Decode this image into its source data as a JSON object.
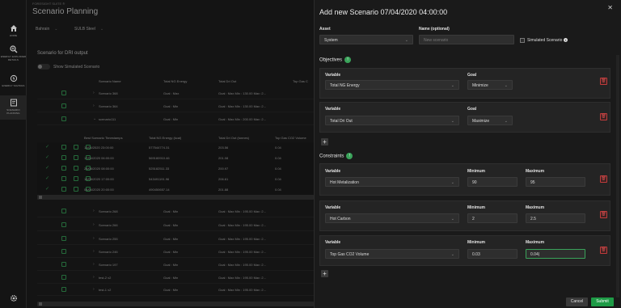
{
  "app": {
    "brand": "FORESIGHT SUITE ®",
    "page_title": "Scenario Planning"
  },
  "nav": {
    "items": [
      {
        "label": "HOME",
        "icon": "home-icon"
      },
      {
        "label": "ENERGY EXPLORER DETAILS",
        "icon": "search-icon"
      },
      {
        "label": "ENERGY SAVINGS",
        "icon": "energy-savings-icon"
      },
      {
        "label": "SCENARIO PLANNING",
        "icon": "scenario-planning-icon"
      }
    ],
    "settings_icon": "gear-icon"
  },
  "filters": {
    "region": "Bahrain",
    "asset": "SULB Steel"
  },
  "section": {
    "title": "Scenario for DRI output",
    "toggle_label": "Show Simulated Scenario"
  },
  "table": {
    "headers": [
      "Scenario Name",
      "Total NG Energy",
      "Total Dri Out",
      "Top Gas C"
    ],
    "rows_top": [
      {
        "name": "Scenario 368",
        "ng": "Goal : Max",
        "dri": "Goal : Max Min : 130.00 Max :2..."
      },
      {
        "name": "Scenario 364",
        "ng": "Goal : Min",
        "dri": "Goal : Max Min : 130.00 Max :2..."
      },
      {
        "name": "scenario111",
        "ng": "Goal : Min",
        "dri": "Goal : Max Min : 200.00 Max :2..."
      }
    ],
    "sub_headers": [
      "Best Scenario Timestamps",
      "Total NG Energy (kcal)",
      "Total Dri Out (tonnes)",
      "Top Gas CO2 Volume"
    ],
    "sub_rows": [
      {
        "ts": "11/04/2020 23:00:00",
        "ng": "577544774.31",
        "dri": "203.56",
        "co2": "0.04"
      },
      {
        "ts": "17/04/2020 06:00:00",
        "ng": "569180910.46",
        "dri": "201.08",
        "co2": "0.04"
      },
      {
        "ts": "28/08/2020 08:00:00",
        "ng": "525182511.33",
        "dri": "200.97",
        "co2": "0.04"
      },
      {
        "ts": "16/08/2020 17:00:00",
        "ng": "543491191.96",
        "dri": "206.61",
        "co2": "0.04"
      },
      {
        "ts": "04/04/2020 20:00:00",
        "ng": "490450657.14",
        "dri": "201.88",
        "co2": "0.04"
      }
    ],
    "rows_bottom": [
      {
        "name": "Scenario 268",
        "ng": "Goal : Min",
        "dri": "Goal : Max Min : 195.00 Max :2..."
      },
      {
        "name": "Scenario 266",
        "ng": "Goal : Min",
        "dri": "Goal : Max Min : 195.00 Max :2..."
      },
      {
        "name": "Scenario 255",
        "ng": "Goal : Min",
        "dri": "Goal : Max Min : 195.00 Max :2..."
      },
      {
        "name": "Scenario 246",
        "ng": "Goal : Min",
        "dri": "Goal : Max Min : 195.00 Max :2..."
      },
      {
        "name": "Scenario 197",
        "ng": "Goal : Min",
        "dri": "Goal : Max Min : 195.00 Max :2..."
      },
      {
        "name": "test-2 v2",
        "ng": "Goal : Min",
        "dri": "Goal : Max Min : 195.00 Max :2..."
      },
      {
        "name": "test-1 v2",
        "ng": "Goal : Min",
        "dri": "Goal : Max Min : 195.00 Max :2..."
      }
    ]
  },
  "panel": {
    "title": "Add new Scenario 07/04/2020 04:00:00",
    "asset_label": "Asset",
    "asset_value": "System",
    "name_label": "Name (optional)",
    "name_placeholder": "New scenario",
    "simulated_label": "Simulated Scenario",
    "objectives": {
      "title": "Objectives",
      "count": "!",
      "items": [
        {
          "variable_label": "Variable",
          "variable": "Total NG Energy",
          "goal_label": "Goal",
          "goal": "Minimize"
        },
        {
          "variable_label": "Variable",
          "variable": "Total Dri Out",
          "goal_label": "Goal",
          "goal": "Maximize"
        }
      ]
    },
    "constraints": {
      "title": "Constraints",
      "count": "!",
      "items": [
        {
          "variable_label": "Variable",
          "variable": "Hot Metalization",
          "min_label": "Minimum",
          "min": "90",
          "max_label": "Maximum",
          "max": "95"
        },
        {
          "variable_label": "Variable",
          "variable": "Hot Carbon",
          "min_label": "Minimum",
          "min": "2",
          "max_label": "Maximum",
          "max": "2.5"
        },
        {
          "variable_label": "Variable",
          "variable": "Top Gas CO2 Volume",
          "min_label": "Minimum",
          "min": "0.03",
          "max_label": "Maximum",
          "max": "0.04|"
        }
      ]
    },
    "add_symbol": "+",
    "cancel_label": "Cancel",
    "submit_label": "Submit"
  },
  "colors": {
    "accent": "#1e9b46",
    "danger": "#c23b3b",
    "panel_bg": "#1a1a1a"
  }
}
